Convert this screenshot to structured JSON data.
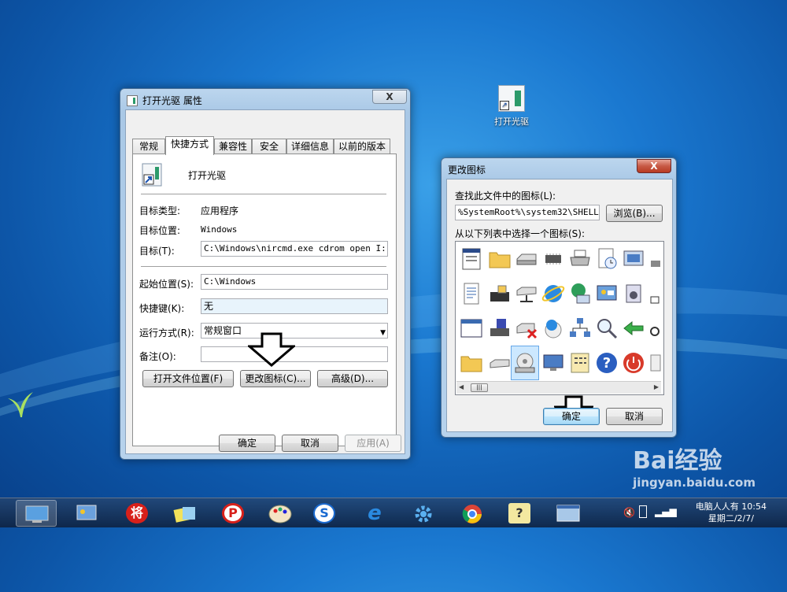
{
  "desktop": {
    "shortcut_label": "打开光驱"
  },
  "props": {
    "title": "打开光驱 属性",
    "close": "X",
    "tabs": [
      "常规",
      "快捷方式",
      "兼容性",
      "安全",
      "详细信息",
      "以前的版本"
    ],
    "name": "打开光驱",
    "target_type_label": "目标类型:",
    "target_type_value": "应用程序",
    "target_location_label": "目标位置:",
    "target_location_value": "Windows",
    "target_label": "目标(T):",
    "target_value": "C:\\Windows\\nircmd.exe cdrom open I:",
    "start_in_label": "起始位置(S):",
    "start_in_value": "C:\\Windows",
    "hotkey_label": "快捷键(K):",
    "hotkey_value": "无",
    "run_label": "运行方式(R):",
    "run_value": "常规窗口",
    "comment_label": "备注(O):",
    "comment_value": "",
    "open_location_button": "打开文件位置(F)",
    "change_icon_button": "更改图标(C)...",
    "advanced_button": "高级(D)...",
    "ok": "确定",
    "cancel": "取消",
    "apply": "应用(A)"
  },
  "change_icon": {
    "title": "更改图标",
    "close": "X",
    "search_label": "查找此文件中的图标(L):",
    "path_value": "%SystemRoot%\\system32\\SHELL32.",
    "browse_button": "浏览(B)...",
    "choose_label": "从以下列表中选择一个图标(S):",
    "ok": "确定",
    "cancel": "取消",
    "scroll_thumb": "|||"
  },
  "taskbar": {
    "clock_line1": "电脑人人有 10:54",
    "clock_line2": "星期二/2/7/",
    "icon_glyphs": [
      "将",
      "P",
      "S",
      "e",
      "?"
    ]
  },
  "watermark": {
    "line1": "Bai经验",
    "line2": "jingyan.baidu.com"
  }
}
